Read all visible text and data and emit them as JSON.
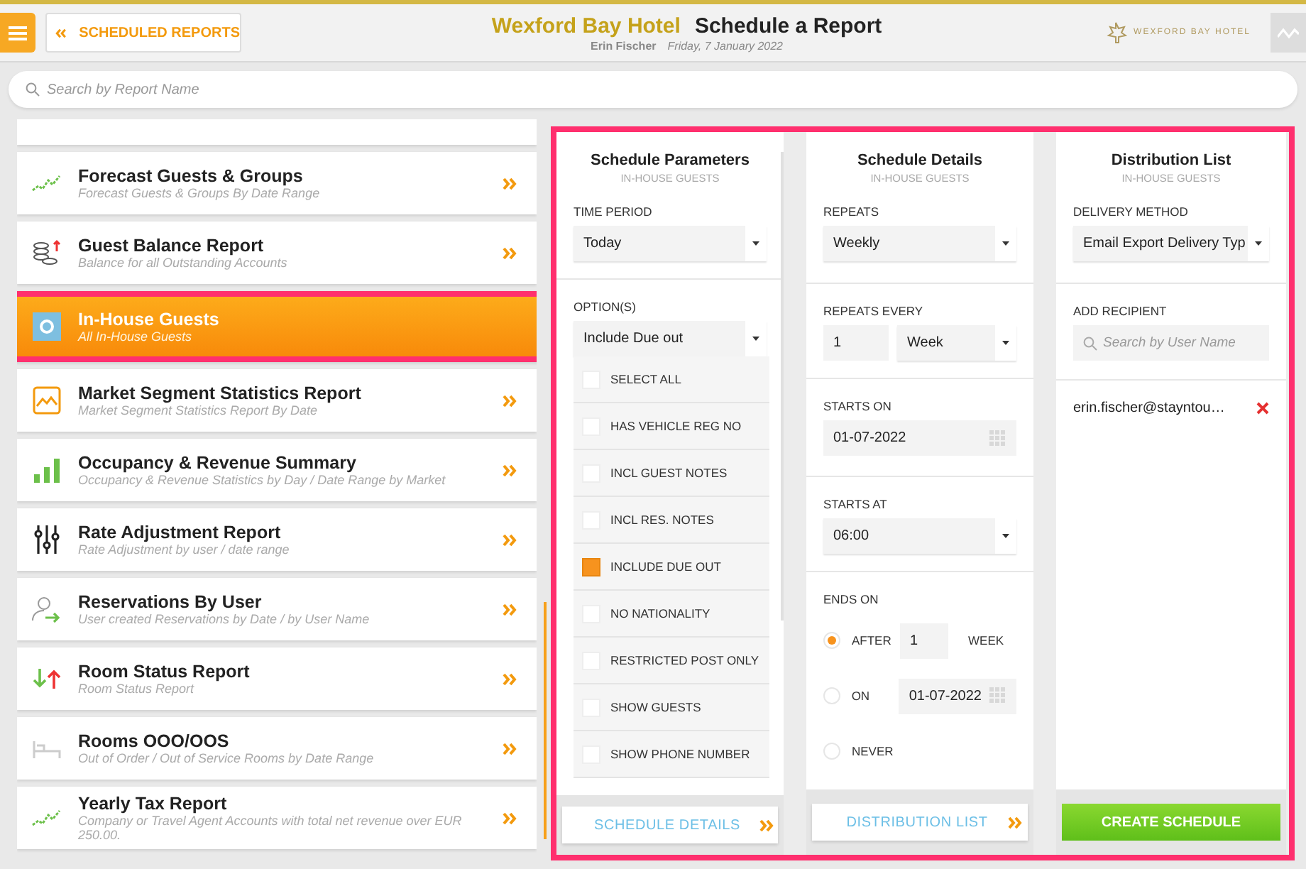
{
  "header": {
    "back_button": "SCHEDULED REPORTS",
    "hotel_name": "Wexford Bay Hotel",
    "page_title": "Schedule a Report",
    "user": "Erin Fischer",
    "date": "Friday, 7 January 2022",
    "logo_text": "WEXFORD BAY HOTEL"
  },
  "search": {
    "placeholder": "Search by Report Name"
  },
  "reports": [
    {
      "title": "Forecast Guests & Groups",
      "subtitle": "Forecast Guests & Groups By Date Range",
      "selected": false
    },
    {
      "title": "Guest Balance Report",
      "subtitle": "Balance for all Outstanding Accounts",
      "selected": false
    },
    {
      "title": "In-House Guests",
      "subtitle": "All In-House Guests",
      "selected": true
    },
    {
      "title": "Market Segment Statistics Report",
      "subtitle": "Market Segment Statistics Report By Date",
      "selected": false
    },
    {
      "title": "Occupancy & Revenue Summary",
      "subtitle": "Occupancy & Revenue Statistics by Day / Date Range by Market",
      "selected": false
    },
    {
      "title": "Rate Adjustment Report",
      "subtitle": "Rate Adjustment by user / date range",
      "selected": false
    },
    {
      "title": "Reservations By User",
      "subtitle": "User created Reservations by Date / by User Name",
      "selected": false
    },
    {
      "title": "Room Status Report",
      "subtitle": "Room Status Report",
      "selected": false
    },
    {
      "title": "Rooms OOO/OOS",
      "subtitle": "Out of Order / Out of Service Rooms by Date Range",
      "selected": false
    },
    {
      "title": "Yearly Tax Report",
      "subtitle": "Company or Travel Agent Accounts with total net revenue over EUR 250.00.",
      "selected": false
    }
  ],
  "parameters": {
    "title": "Schedule Parameters",
    "subtitle": "IN-HOUSE GUESTS",
    "time_period": {
      "label": "TIME PERIOD",
      "value": "Today"
    },
    "options": {
      "label": "OPTION(S)",
      "value": "Include Due out",
      "items": [
        {
          "label": "SELECT ALL",
          "checked": false
        },
        {
          "label": "HAS VEHICLE REG NO",
          "checked": false
        },
        {
          "label": "INCL GUEST NOTES",
          "checked": false
        },
        {
          "label": "INCL RES. NOTES",
          "checked": false
        },
        {
          "label": "INCLUDE DUE OUT",
          "checked": true
        },
        {
          "label": "NO NATIONALITY",
          "checked": false
        },
        {
          "label": "RESTRICTED POST ONLY",
          "checked": false
        },
        {
          "label": "SHOW GUESTS",
          "checked": false
        },
        {
          "label": "SHOW PHONE NUMBER",
          "checked": false
        }
      ]
    },
    "next_button": "SCHEDULE DETAILS"
  },
  "details": {
    "title": "Schedule Details",
    "subtitle": "IN-HOUSE GUESTS",
    "repeats": {
      "label": "REPEATS",
      "value": "Weekly"
    },
    "repeats_every": {
      "label": "REPEATS EVERY",
      "count": "1",
      "unit": "Week"
    },
    "starts_on": {
      "label": "STARTS ON",
      "value": "01-07-2022"
    },
    "starts_at": {
      "label": "STARTS AT",
      "value": "06:00"
    },
    "ends_on": {
      "label": "ENDS ON",
      "options": [
        {
          "kind": "after",
          "label": "AFTER",
          "selected": true,
          "count": "1",
          "unit": "WEEK"
        },
        {
          "kind": "on",
          "label": "ON",
          "selected": false,
          "date": "01-07-2022"
        },
        {
          "kind": "never",
          "label": "NEVER",
          "selected": false
        }
      ]
    },
    "next_button": "DISTRIBUTION LIST"
  },
  "distribution": {
    "title": "Distribution List",
    "subtitle": "IN-HOUSE GUESTS",
    "delivery": {
      "label": "DELIVERY METHOD",
      "value": "Email Export Delivery Typ"
    },
    "add_recipient": {
      "label": "ADD RECIPIENT",
      "placeholder": "Search by User Name"
    },
    "recipients": [
      {
        "email": "erin.fischer@stayntou…"
      }
    ],
    "create_button": "CREATE SCHEDULE"
  }
}
